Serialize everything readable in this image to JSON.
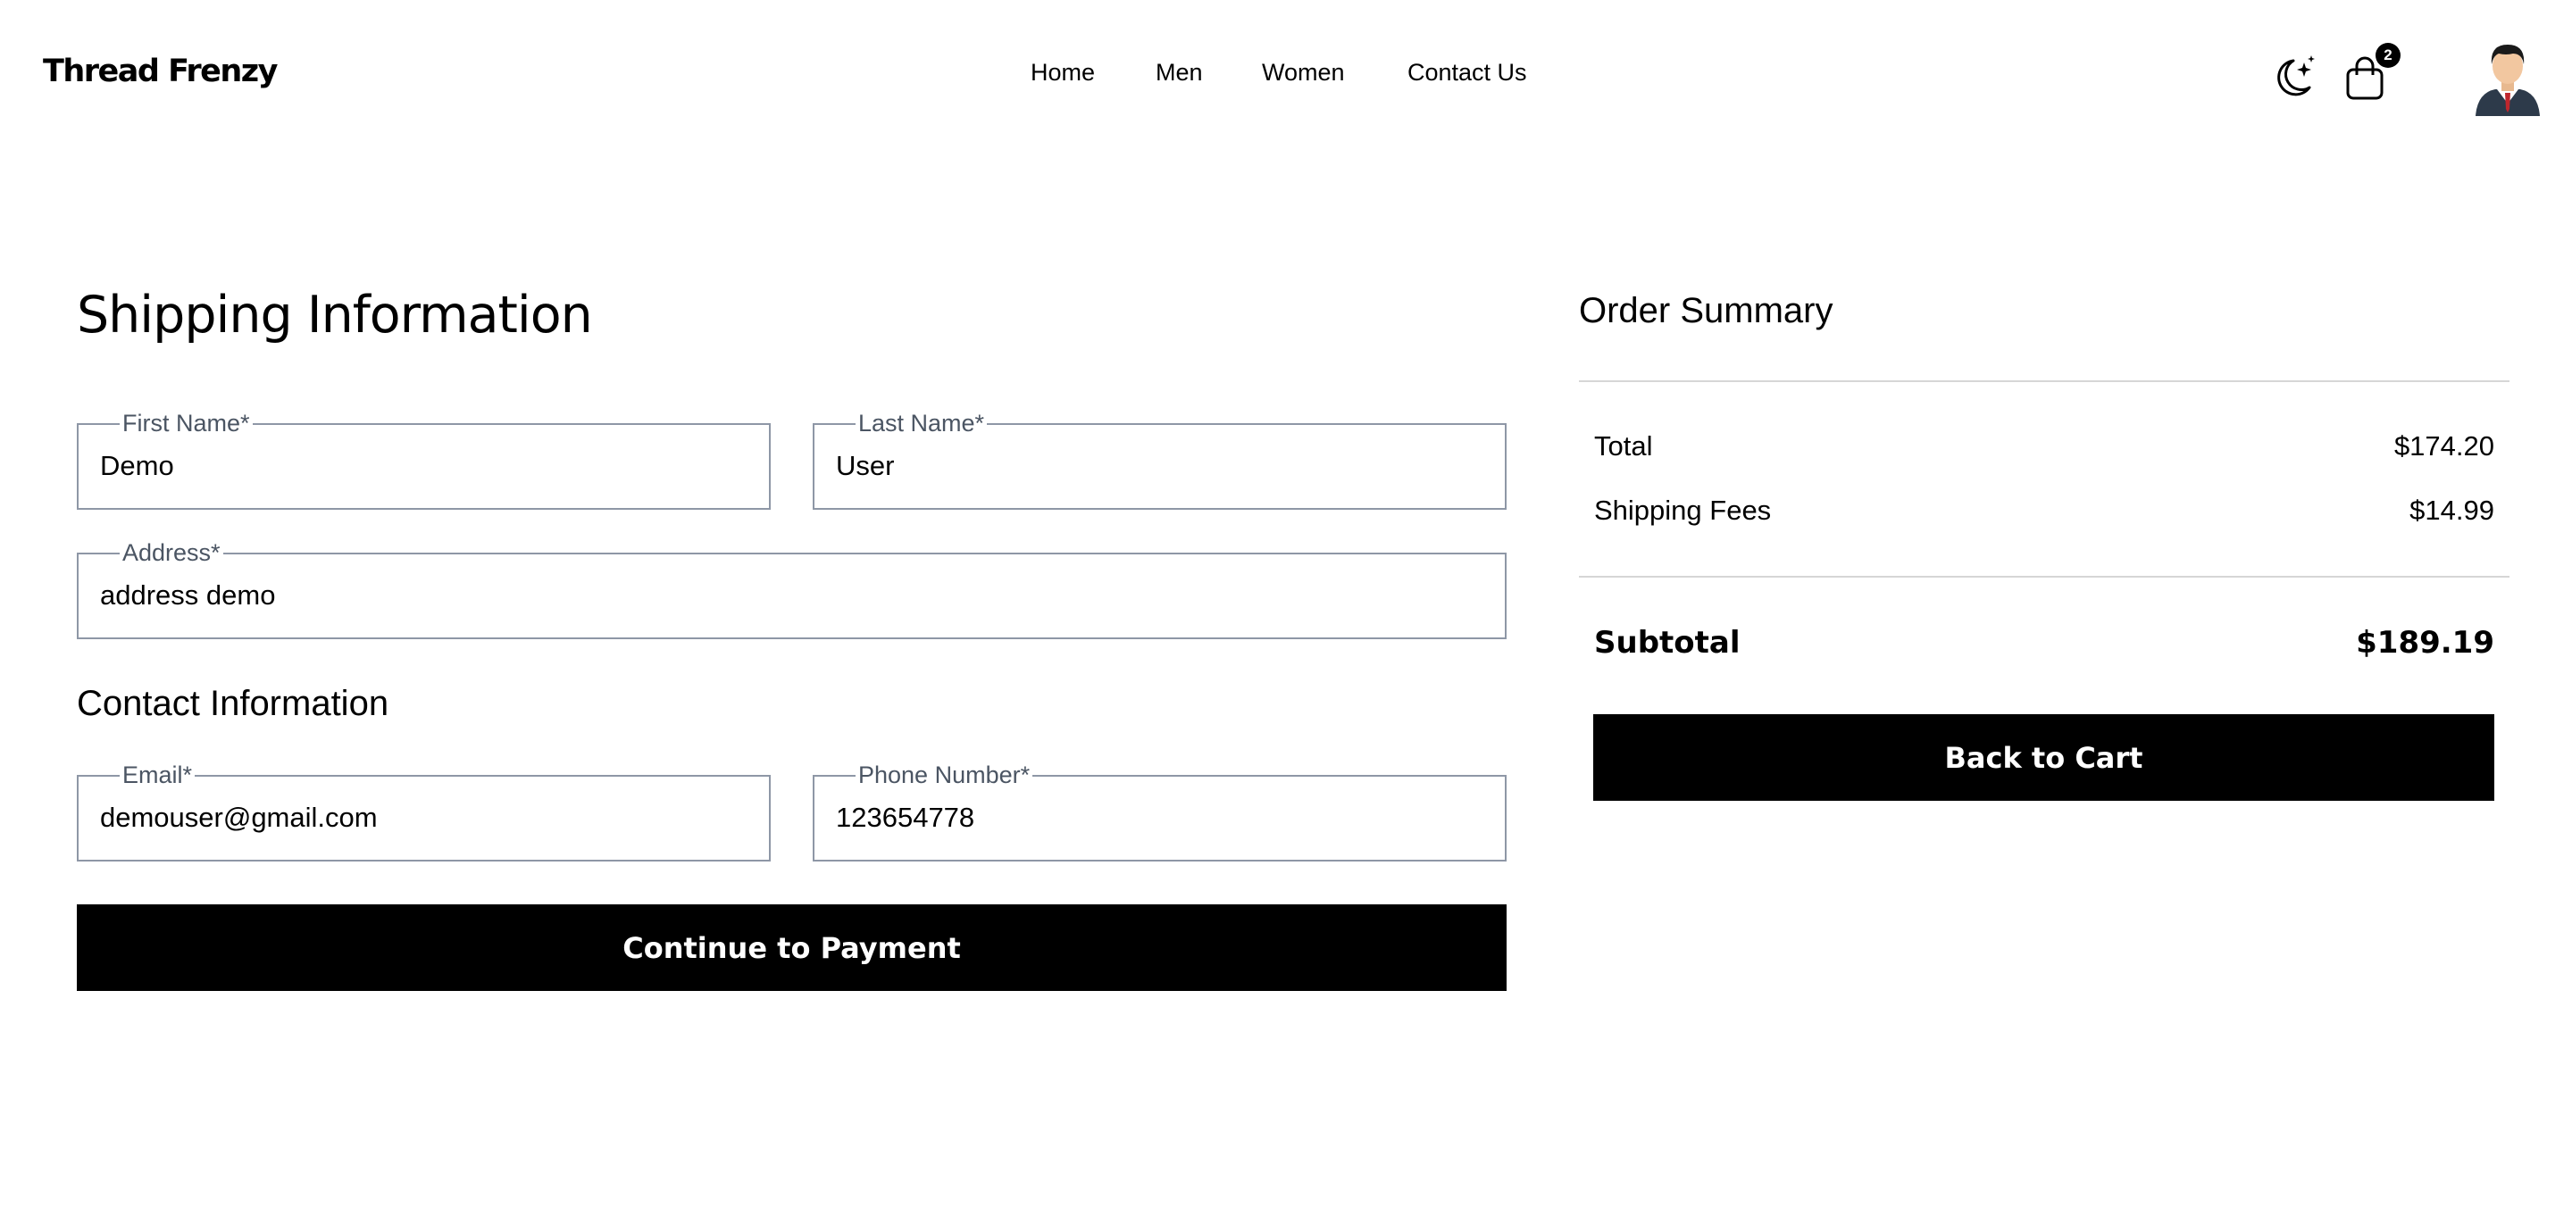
{
  "header": {
    "logo": "Thread Frenzy",
    "nav": [
      "Home",
      "Men",
      "Women",
      "Contact Us"
    ],
    "cart_count": "2",
    "icons": [
      "moon-stars-icon",
      "shopping-bag-icon",
      "user-avatar"
    ]
  },
  "shipping": {
    "title": "Shipping Information",
    "first_name": {
      "label": "First Name*",
      "value": "Demo"
    },
    "last_name": {
      "label": "Last Name*",
      "value": "User"
    },
    "address": {
      "label": "Address*",
      "value": "address demo"
    }
  },
  "contact": {
    "title": "Contact Information",
    "email": {
      "label": "Email*",
      "value": "demouser@gmail.com"
    },
    "phone": {
      "label": "Phone Number*",
      "value": "123654778"
    }
  },
  "continue_label": "Continue to Payment",
  "summary": {
    "title": "Order Summary",
    "total_label": "Total",
    "total_value": "$174.20",
    "shipping_label": "Shipping Fees",
    "shipping_value": "$14.99",
    "subtotal_label": "Subtotal",
    "subtotal_value": "$189.19",
    "back_label": "Back to Cart"
  },
  "colors": {
    "accent": "#000000",
    "field_border": "#8e97a6",
    "label": "#4b5563",
    "divider": "#d6d6d6"
  }
}
